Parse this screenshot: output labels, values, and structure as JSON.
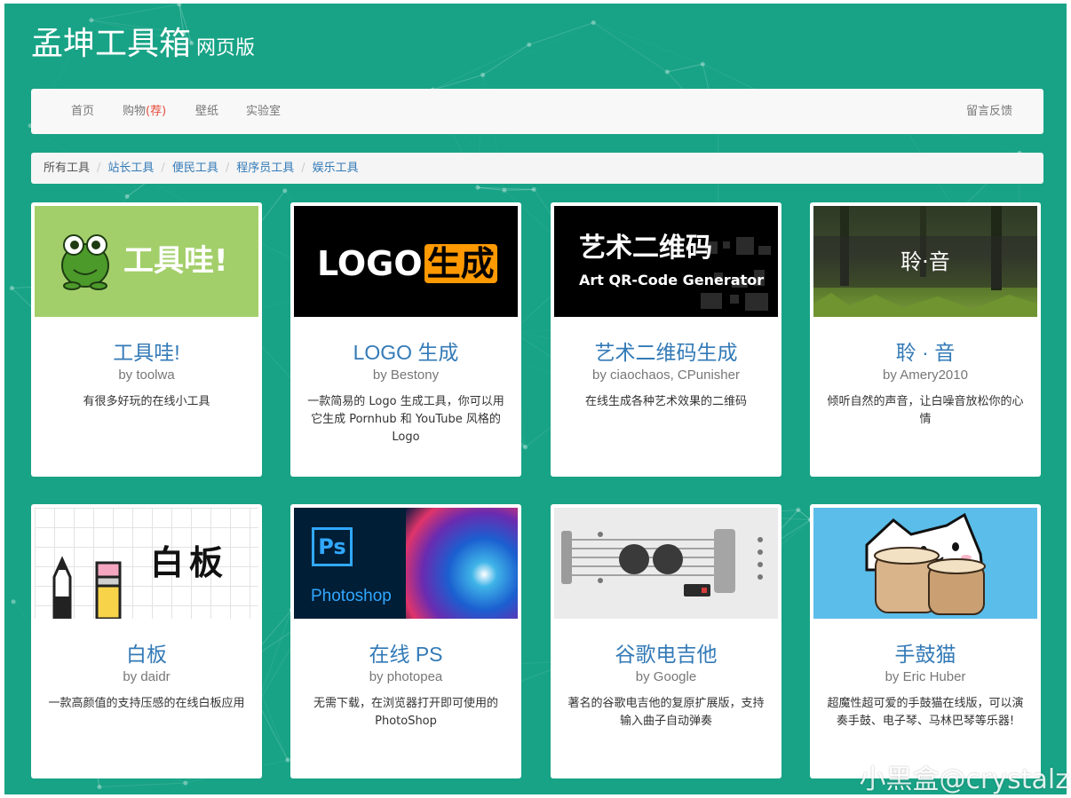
{
  "header": {
    "title": "孟坤工具箱",
    "subtitle": "网页版"
  },
  "nav": {
    "home": "首页",
    "shop": "购物",
    "shop_badge": "(荐)",
    "wallpaper": "壁纸",
    "lab": "实验室",
    "feedback": "留言反馈"
  },
  "breadcrumb": [
    "所有工具",
    "站长工具",
    "便民工具",
    "程序员工具",
    "娱乐工具"
  ],
  "thumbs": {
    "toolwa": "工具哇!",
    "logo_a": "LOGO",
    "logo_b": "生成",
    "qr_title": "艺术二维码",
    "qr_sub": "Art QR-Code Generator",
    "lingyin": "聆·音",
    "whiteboard": "白板",
    "ps_icon": "Ps",
    "ps_name": "Photoshop"
  },
  "cards": [
    {
      "title": "工具哇!",
      "author": "by toolwa",
      "desc": "有很多好玩的在线小工具",
      "icon": "frog-icon"
    },
    {
      "title": "LOGO 生成",
      "author": "by Bestony",
      "desc": "一款简易的 Logo 生成工具，你可以用它生成 Pornhub 和 YouTube 风格的 Logo"
    },
    {
      "title": "艺术二维码生成",
      "author": "by ciaochaos, CPunisher",
      "desc": "在线生成各种艺术效果的二维码",
      "icon": "qr-icon"
    },
    {
      "title": "聆 · 音",
      "author": "by Amery2010",
      "desc": "倾听自然的声音，让白噪音放松你的心情",
      "icon": "forest-image"
    },
    {
      "title": "白板",
      "author": "by daidr",
      "desc": "一款高颜值的支持压感的在线白板应用",
      "icon": "pencil-icon"
    },
    {
      "title": "在线 PS",
      "author": "by photopea",
      "desc": "无需下载，在浏览器打开即可使用的 PhotoShop",
      "icon": "photoshop-icon"
    },
    {
      "title": "谷歌电吉他",
      "author": "by Google",
      "desc": "著名的谷歌电吉他的复原扩展版，支持输入曲子自动弹奏",
      "icon": "guitar-icon"
    },
    {
      "title": "手鼓猫",
      "author": "by Eric Huber",
      "desc": "超魔性超可爱的手鼓猫在线版，可以演奏手鼓、电子琴、马林巴琴等乐器!",
      "icon": "bongo-cat-icon"
    }
  ],
  "watermark": "小黑盒@crystalz",
  "colors": {
    "bg": "#18a386",
    "link": "#337ab7",
    "badge": "#e74c3c"
  }
}
